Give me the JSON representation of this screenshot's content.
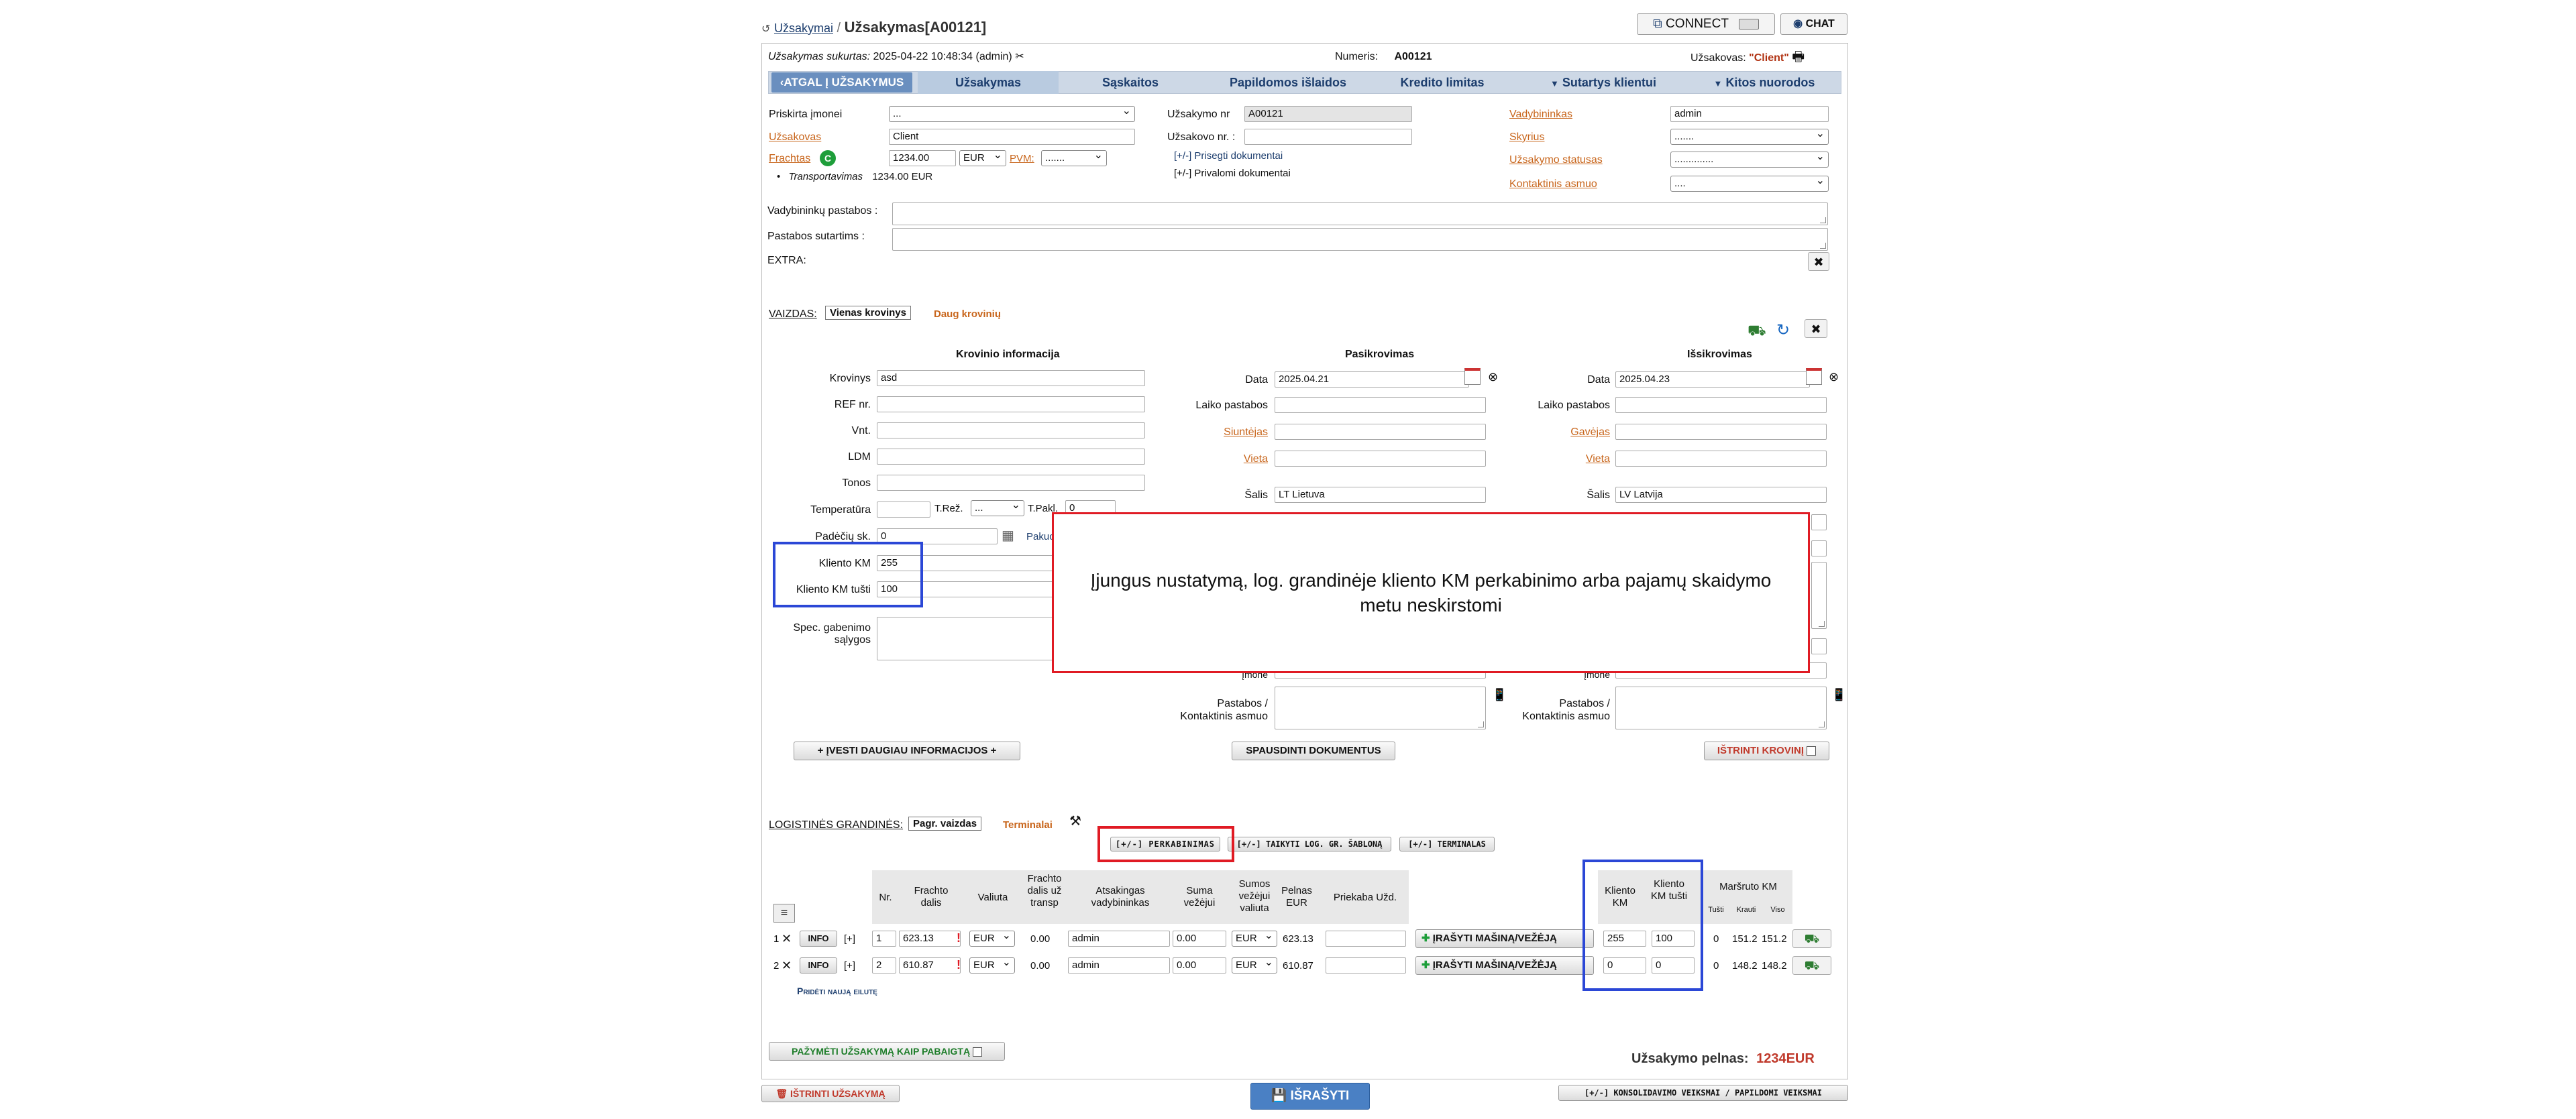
{
  "header": {
    "breadcrumb_link": "Užsakymai",
    "breadcrumb_sep": "/",
    "title": "Užsakymas[A00121]",
    "connect_label": "CONNECT",
    "chat_label": "CHAT"
  },
  "infobar": {
    "created_label": "Užsakymas sukurtas:",
    "created_value": "2025-04-22 10:48:34 (admin)",
    "number_label": "Numeris:",
    "number_value": "A00121",
    "customer_label": "Užsakovas:",
    "customer_value": "\"Client\""
  },
  "tabs": {
    "back": "ATGAL Į UŽSAKYMUS",
    "order": "Užsakymas",
    "invoices": "Sąskaitos",
    "extra_costs": "Papildomos išlaidos",
    "credit_limit": "Kredito limitas",
    "contract": "Sutartys klientui",
    "other_links": "Kitos nuorodos"
  },
  "form": {
    "company_label": "Priskirta įmonei",
    "company_value": "...",
    "customer_label": "Užsakovas",
    "customer_value": "Client",
    "freight_label": "Frachtas",
    "freight_badge": "C",
    "freight_value": "1234.00",
    "currency": "EUR",
    "vat_label": "PVM:",
    "vat_value": ".......",
    "transport_label": "Transportavimas",
    "transport_value": "1234.00 EUR",
    "order_no_label": "Užsakymo nr",
    "order_no_value": "A00121",
    "client_order_label": "Užsakovo nr. :",
    "attach_docs": "[+/-] Prisegti dokumentai",
    "required_docs": "[+/-] Privalomi dokumentai",
    "manager_label": "Vadybininkas",
    "manager_value": "admin",
    "department_label": "Skyrius",
    "department_value": ".......",
    "status_label": "Užsakymo statusas",
    "status_value": "..............",
    "contact_label": "Kontaktinis asmuo",
    "contact_value": "....",
    "manager_notes_label": "Vadybininkų pastabos :",
    "contract_notes_label": "Pastabos sutartims :",
    "extra_label": "EXTRA:"
  },
  "views": {
    "label": "VAIZDAS:",
    "single": "Vienas krovinys",
    "multiple": "Daug krovinių"
  },
  "cargo": {
    "title": "Krovinio informacija",
    "cargo_label": "Krovinys",
    "cargo_value": "asd",
    "ref_label": "REF nr.",
    "units_label": "Vnt.",
    "ldm_label": "LDM",
    "tons_label": "Tonos",
    "temp_label": "Temperatūra",
    "tmode_label": "T.Rež.",
    "tmode_value": "...",
    "tpak_label": "T.Pakl.",
    "tpak_value": "0",
    "pallets_label": "Padėčių sk.",
    "pallets_value": "0",
    "packing_label": "Pakuo",
    "client_km_label": "Kliento KM",
    "client_km_value": "255",
    "client_km_empty_label": "Kliento KM tušti",
    "client_km_empty_value": "100",
    "special_label_1": "Spec. gabenimo",
    "special_label_2": "sąlygos"
  },
  "loading": {
    "title": "Pasikrovimas",
    "date_label": "Data",
    "date_value": "2025.04.21",
    "time_notes_label": "Laiko pastabos",
    "sender_label": "Siuntėjas",
    "place_label": "Vieta",
    "country_label": "Šalis",
    "country_value": "LT Lietuva",
    "company_partial": "Įmonė",
    "notes_label_1": "Pastabos /",
    "notes_label_2": "Kontaktinis asmuo"
  },
  "unloading": {
    "title": "Išsikrovimas",
    "date_label": "Data",
    "date_value": "2025.04.23",
    "time_notes_label": "Laiko pastabos",
    "receiver_label": "Gavėjas",
    "place_label": "Vieta",
    "country_label": "Šalis",
    "country_value": "LV Latvija",
    "company_partial": "Įmonė",
    "notes_label_1": "Pastabos /",
    "notes_label_2": "Kontaktinis asmuo"
  },
  "actions": {
    "more_info": "+ ĮVESTI DAUGIAU INFORMACIJOS +",
    "print_docs": "SPAUSDINTI DOKUMENTUS",
    "delete_cargo": "IŠTRINTI KROVINĮ"
  },
  "overlay": {
    "message": "Įjungus nustatymą, log. grandinėje kliento KM perkabinimo arba pajamų skaidymo metu neskirstomi"
  },
  "chain": {
    "label": "LOGISTINĖS GRANDINĖS:",
    "main_view": "Pagr. vaizdas",
    "terminals": "Terminalai",
    "btn_rehook": "[+/-] PERKABINIMAS",
    "btn_template": "[+/-] TAIKYTI LOG. GR. ŠABLONĄ",
    "btn_terminal": "[+/-] TERMINALAS",
    "headers": {
      "nr": "Nr.",
      "freight_part": "Frachto dalis",
      "currency": "Valiuta",
      "freight_part_transp": "Frachto dalis už transp",
      "manager": "Atsakingas vadybininkas",
      "carrier_sum": "Suma vežėjui",
      "carrier_currency": "Sumos vežėjui valiuta",
      "profit": "Pelnas EUR",
      "trailer": "Priekaba Užd.",
      "client_km": "Kliento KM",
      "client_km_empty": "Kliento KM tušti",
      "route_km": "Maršruto KM",
      "route_empty": "Tušti",
      "route_loaded": "Krauti",
      "route_total": "Viso"
    },
    "rows": [
      {
        "idx": "1",
        "info": "INFO",
        "plus": "[+]",
        "nr": "1",
        "freight": "623.13",
        "currency": "EUR",
        "transp": "0.00",
        "manager": "admin",
        "carrier_sum": "0.00",
        "carrier_cur": "EUR",
        "profit": "623.13",
        "trailer": "",
        "truck_btn": "ĮRAŠYTI MAŠINĄ/VEŽĖJĄ",
        "km": "255",
        "km_empty": "100",
        "r_empty": "0",
        "r_loaded": "151.2",
        "r_total": "151.2"
      },
      {
        "idx": "2",
        "info": "INFO",
        "plus": "[+]",
        "nr": "2",
        "freight": "610.87",
        "currency": "EUR",
        "transp": "0.00",
        "manager": "admin",
        "carrier_sum": "0.00",
        "carrier_cur": "EUR",
        "profit": "610.87",
        "trailer": "",
        "truck_btn": "ĮRAŠYTI MAŠINĄ/VEŽĖJĄ",
        "km": "0",
        "km_empty": "0",
        "r_empty": "0",
        "r_loaded": "148.2",
        "r_total": "148.2"
      }
    ],
    "add_row": "Pridėti naują eilutę"
  },
  "footer": {
    "mark_done": "PAŽYMĖTI UŽSAKYMĄ KAIP PABAIGTĄ",
    "profit_label": "Užsakymo pelnas:",
    "profit_value": "1234EUR",
    "delete_order": "IŠTRINTI UŽSAKYMĄ",
    "save": "IŠRAŠYTI",
    "consolidation": "[+/-] KONSOLIDAVIMO VEIKSMAI / PAPILDOMI VEIKSMAI"
  },
  "colors": {
    "tab_bg": "#cdd8e6",
    "tab_active": "#b9cbe0",
    "back_btn": "#6a8fbf",
    "highlight_red": "#e01b24",
    "highlight_blue": "#2b47d6",
    "save_btn": "#4a80c4",
    "profit_red": "#c0392b"
  }
}
